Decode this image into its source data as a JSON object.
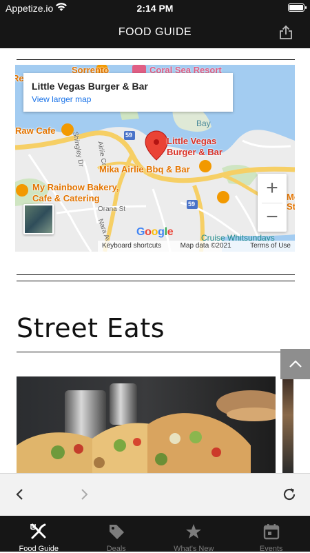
{
  "status_bar": {
    "carrier": "Appetize.io",
    "time": "2:14 PM"
  },
  "nav": {
    "title": "FOOD GUIDE"
  },
  "map": {
    "card_title": "Little Vegas Burger & Bar",
    "card_link": "View larger map",
    "labels": {
      "sorrento": "Sorrento",
      "coral_sea": "Coral Sea Resort",
      "raw_cafe": "Raw Cafe",
      "bay": "Bay",
      "little_vegas_1": "Little Vegas",
      "little_vegas_2": "Burger & Bar",
      "mika": "Mika Airlie Bbq & Bar",
      "rainbow_1": "My Rainbow Bakery,",
      "rainbow_2": "Cafe & Catering",
      "orana": "Orana St",
      "nara": "Nara Ave",
      "shingley": "Shingley Dr",
      "airlie_cr": "Airlie Cr",
      "cruise": "Cruise Whitsundays",
      "route": "59",
      "route2": "59",
      "edge_r": "Re",
      "edge_mo": "Mo",
      "edge_sta": "Sta"
    },
    "google": [
      "G",
      "o",
      "o",
      "g",
      "l",
      "e"
    ],
    "attrib": {
      "shortcuts": "Keyboard shortcuts",
      "data": "Map data ©2021",
      "terms": "Terms of Use"
    },
    "zoom_in": "+",
    "zoom_out": "−"
  },
  "section": {
    "title": "Street Eats"
  },
  "tabs": [
    {
      "label": "Food Guide",
      "icon": "fork-knife-icon",
      "active": true
    },
    {
      "label": "Deals",
      "icon": "tag-icon",
      "active": false
    },
    {
      "label": "What's New",
      "icon": "star-icon",
      "active": false
    },
    {
      "label": "Events",
      "icon": "calendar-icon",
      "active": false
    }
  ],
  "colors": {
    "nav_bg": "#161616",
    "map_water": "#a3ccf1",
    "map_road": "#f6cf65",
    "pin": "#d93025",
    "accent_link": "#1a73e8"
  }
}
